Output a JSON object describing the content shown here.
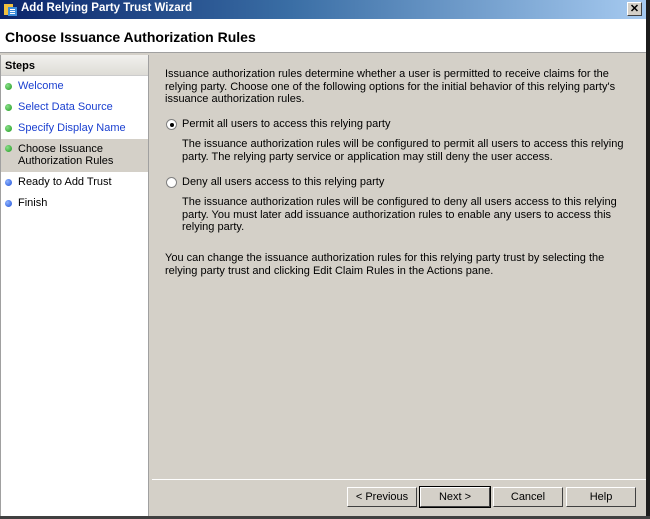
{
  "window": {
    "title": "Add Relying Party Trust Wizard",
    "close_label": "✕"
  },
  "header": {
    "title": "Choose Issuance Authorization Rules"
  },
  "sidebar": {
    "header": "Steps",
    "items": [
      {
        "label": "Welcome",
        "status": "completed",
        "link": true
      },
      {
        "label": "Select Data Source",
        "status": "completed",
        "link": true
      },
      {
        "label": "Specify Display Name",
        "status": "completed",
        "link": true
      },
      {
        "label": "Choose Issuance Authorization Rules",
        "line1": "Choose Issuance",
        "line2": "Authorization Rules",
        "status": "current",
        "link": false
      },
      {
        "label": "Ready to Add Trust",
        "status": "pending",
        "link": false
      },
      {
        "label": "Finish",
        "status": "pending",
        "link": false
      }
    ]
  },
  "main": {
    "intro": "Issuance authorization rules determine whether a user is permitted to receive claims for the relying party. Choose one of the following options for the initial behavior of this relying party's issuance authorization rules.",
    "options": [
      {
        "label": "Permit all users to access this relying party",
        "checked": true,
        "description": "The issuance authorization rules will be configured to permit all users to access this relying party. The relying party service or application may still deny the user access."
      },
      {
        "label": "Deny all users access to this relying party",
        "checked": false,
        "description": "The issuance authorization rules will be configured to deny all users access to this relying party. You must later add issuance authorization rules to enable any users to access this relying party."
      }
    ],
    "note": "You can change the issuance authorization rules for this relying party trust by selecting the relying party trust and clicking Edit Claim Rules in the Actions pane."
  },
  "buttons": {
    "previous": "< Previous",
    "next": "Next >",
    "cancel": "Cancel",
    "help": "Help"
  },
  "colors": {
    "completed_dot": "#1f9a1f",
    "pending_dot": "#1e50d8",
    "link": "#1a3fd0",
    "dialog_bg": "#d4d0c8"
  }
}
